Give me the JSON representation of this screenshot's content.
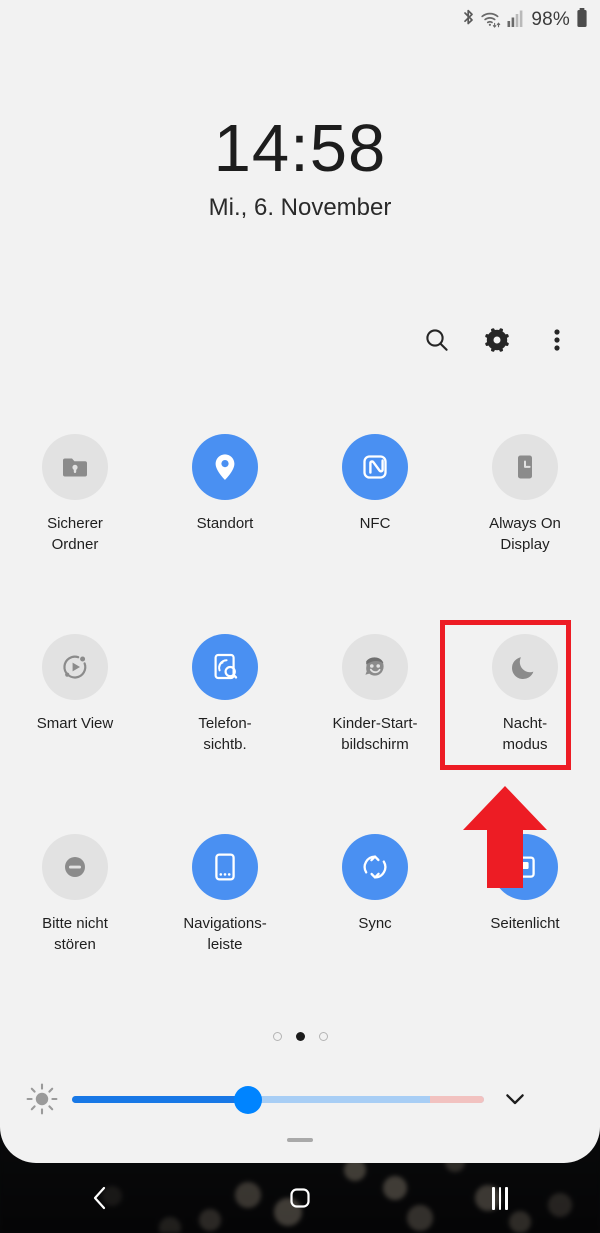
{
  "status_bar": {
    "bluetooth_icon": "bluetooth-icon",
    "wifi_icon": "wifi-icon",
    "signal_icon": "cellular-signal-icon",
    "battery_percent": "98%",
    "battery_icon": "battery-full-icon"
  },
  "lock_screen": {
    "time": "14:58",
    "date": "Mi., 6. November"
  },
  "toolbar": {
    "search": {
      "name": "search-icon",
      "label": "Suchen"
    },
    "settings": {
      "name": "gear-icon",
      "label": "Einstellungen"
    },
    "more": {
      "name": "more-vertical-icon",
      "label": "Mehr"
    }
  },
  "quick_settings": {
    "accent_on": "#4a90f2",
    "accent_off": "#e2e2e2",
    "rows": [
      [
        {
          "label": "Sicherer\nOrdner",
          "icon": "secure-folder-icon",
          "state": "off"
        },
        {
          "label": "Standort",
          "icon": "location-pin-icon",
          "state": "on"
        },
        {
          "label": "NFC",
          "icon": "nfc-icon",
          "state": "on"
        },
        {
          "label": "Always On\nDisplay",
          "icon": "always-on-display-icon",
          "state": "off"
        }
      ],
      [
        {
          "label": "Smart View",
          "icon": "smart-view-icon",
          "state": "off"
        },
        {
          "label": "Telefon-\nsichtb.",
          "icon": "phone-visibility-icon",
          "state": "on"
        },
        {
          "label": "Kinder-Start-\nbildschirm",
          "icon": "kids-home-icon",
          "state": "off"
        },
        {
          "label": "Nacht-\nmodus",
          "icon": "moon-icon",
          "state": "off"
        }
      ],
      [
        {
          "label": "Bitte nicht\nstören",
          "icon": "do-not-disturb-icon",
          "state": "off"
        },
        {
          "label": "Navigations-\nleiste",
          "icon": "navigation-bar-icon",
          "state": "on"
        },
        {
          "label": "Sync",
          "icon": "sync-icon",
          "state": "on"
        },
        {
          "label": "Seitenlicht",
          "icon": "edge-lighting-icon",
          "state": "on"
        }
      ]
    ]
  },
  "annotation": {
    "color": "#ed1c24",
    "highlight_target": "Nacht-modus",
    "arrow": "red-up-arrow"
  },
  "page_indicator": {
    "total": 3,
    "active_index": 1
  },
  "brightness": {
    "icon": "brightness-icon",
    "value_percent": 45,
    "expand_icon": "chevron-down-icon"
  },
  "handle": {
    "name": "panel-grab-handle"
  },
  "nav_bar": {
    "back": "back-icon",
    "home": "home-icon",
    "recents": "recents-icon"
  }
}
